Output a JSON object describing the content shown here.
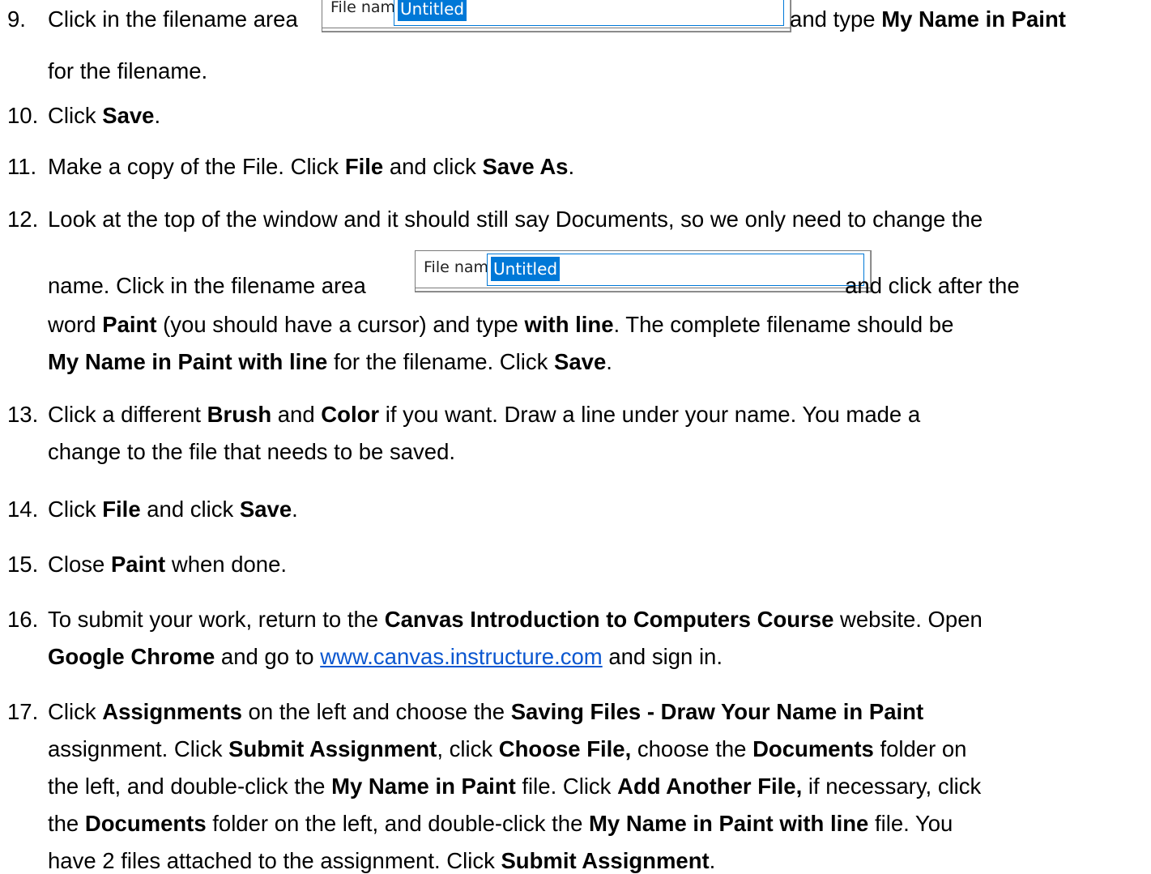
{
  "filename_widget": {
    "label": "File name:",
    "value": "Untitled"
  },
  "steps": [
    {
      "number": "9.",
      "lines": [
        [
          {
            "t": "Click in the filename area "
          },
          {
            "widget": "fn"
          },
          {
            "t": " and type "
          },
          {
            "b": "My Name in Paint"
          }
        ],
        [
          {
            "t": "for the filename."
          }
        ]
      ]
    },
    {
      "number": "10.",
      "lines": [
        [
          {
            "t": "Click "
          },
          {
            "b": "Save"
          },
          {
            "t": "."
          }
        ]
      ]
    },
    {
      "number": "11.",
      "lines": [
        [
          {
            "t": "Make a copy of the File. Click "
          },
          {
            "b": "File"
          },
          {
            "t": " and click "
          },
          {
            "b": "Save As"
          },
          {
            "t": "."
          }
        ]
      ]
    },
    {
      "number": "12.",
      "lines": [
        [
          {
            "t": "Look at the top of the window and it should still say Documents, so we only need to change the"
          }
        ],
        [
          {
            "t": "name. Click in the filename area "
          },
          {
            "widget": "fn"
          },
          {
            "t": " and click after the"
          }
        ],
        [
          {
            "t": "word "
          },
          {
            "b": "Paint"
          },
          {
            "t": " (you should have a cursor) and type "
          },
          {
            "b": "with line"
          },
          {
            "t": ". The complete filename should be"
          }
        ],
        [
          {
            "b": "My Name in Paint with line"
          },
          {
            "t": " for the filename. Click "
          },
          {
            "b": "Save"
          },
          {
            "t": "."
          }
        ]
      ]
    },
    {
      "number": "13.",
      "lines": [
        [
          {
            "t": "Click a different "
          },
          {
            "b": "Brush"
          },
          {
            "t": " and "
          },
          {
            "b": "Color"
          },
          {
            "t": " if you want. Draw a line under your name. You made a"
          }
        ],
        [
          {
            "t": "change to the file that needs to be saved."
          }
        ]
      ]
    },
    {
      "number": "14.",
      "lines": [
        [
          {
            "t": "Click "
          },
          {
            "b": "File"
          },
          {
            "t": " and click "
          },
          {
            "b": "Save"
          },
          {
            "t": "."
          }
        ]
      ]
    },
    {
      "number": "15.",
      "lines": [
        [
          {
            "t": "Close "
          },
          {
            "b": "Paint"
          },
          {
            "t": " when done."
          }
        ]
      ]
    },
    {
      "number": "16.",
      "lines": [
        [
          {
            "t": "To submit your work, return to the "
          },
          {
            "b": "Canvas Introduction to Computers Course"
          },
          {
            "t": " website. Open"
          }
        ],
        [
          {
            "b": "Google Chrome"
          },
          {
            "t": " and go to "
          },
          {
            "a": "www.canvas.instructure.com"
          },
          {
            "t": " and sign in."
          }
        ]
      ]
    },
    {
      "number": "17.",
      "lines": [
        [
          {
            "t": "Click "
          },
          {
            "b": "Assignments"
          },
          {
            "t": " on the left and choose the "
          },
          {
            "b": "Saving Files - Draw Your Name in Paint"
          }
        ],
        [
          {
            "t": "assignment. Click "
          },
          {
            "b": "Submit Assignment"
          },
          {
            "t": ", click "
          },
          {
            "b": "Choose File,"
          },
          {
            "t": " choose the "
          },
          {
            "b": "Documents"
          },
          {
            "t": " folder on"
          }
        ],
        [
          {
            "t": "the left, and double-click the "
          },
          {
            "b": "My Name in Paint"
          },
          {
            "t": " file. Click "
          },
          {
            "b": "Add Another File,"
          },
          {
            "t": " if necessary, click"
          }
        ],
        [
          {
            "t": "the "
          },
          {
            "b": "Documents"
          },
          {
            "t": " folder on the left, and double-click the "
          },
          {
            "b": "My Name in Paint with line"
          },
          {
            "t": " file. You"
          }
        ],
        [
          {
            "t": "have 2 files attached to the assignment. Click "
          },
          {
            "b": "Submit Assignment"
          },
          {
            "t": "."
          }
        ]
      ]
    }
  ]
}
